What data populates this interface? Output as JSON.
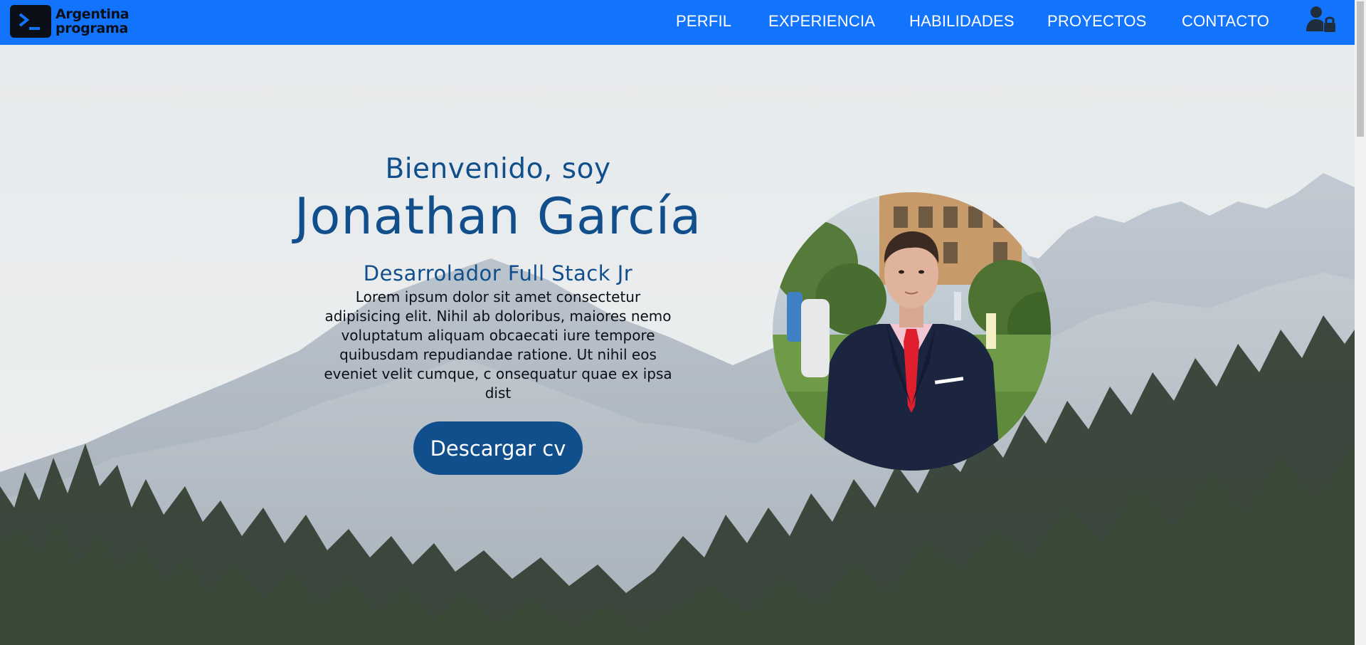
{
  "navbar": {
    "logo_line1": "Argentina",
    "logo_line2": "programa",
    "links": [
      "PERFIL",
      "EXPERIENCIA",
      "HABILIDADES",
      "PROYECTOS",
      "CONTACTO"
    ],
    "login_icon": "user-lock-icon"
  },
  "hero": {
    "greeting": "Bienvenido, soy",
    "name": "Jonathan García",
    "role": "Desarrolador Full Stack Jr",
    "description": "Lorem ipsum dolor sit amet consectetur adipisicing elit. Nihil ab doloribus, maiores nemo voluptatum aliquam obcaecati iure tempore quibusdam repudiandae ratione. Ut nihil eos eveniet velit cumque, c onsequatur quae ex ipsa dist",
    "cv_button": "Descargar cv"
  },
  "colors": {
    "nav_blue": "#1273fc",
    "heading_blue": "#114f8c",
    "button_blue": "#114f8c"
  }
}
